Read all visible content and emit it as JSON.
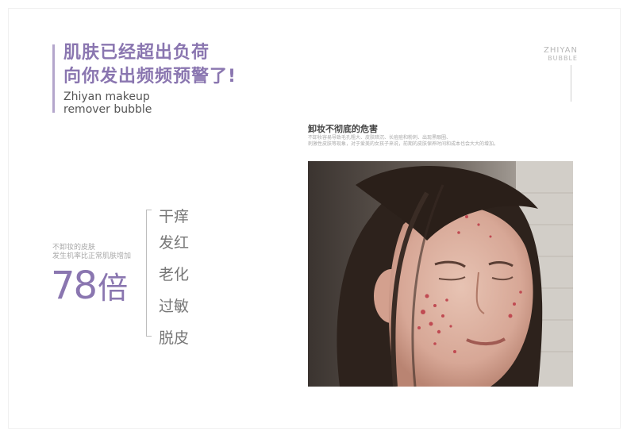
{
  "headline": {
    "line1": "肌肤已经超出负荷",
    "line2": "向你发出频频预警了!"
  },
  "subtitle": {
    "line1": "Zhiyan makeup",
    "line2": "remover bubble"
  },
  "brand": {
    "line1": "ZHIYAN",
    "line2": "BUBBLE"
  },
  "stat": {
    "label_line1": "不卸妆的皮肤",
    "label_line2": "发生机率比正常肌肤增加",
    "number": "78",
    "unit": "倍"
  },
  "symptoms": [
    "干痒",
    "发红",
    "老化",
    "过敏",
    "脱皮"
  ],
  "panel": {
    "title": "卸妆不彻底的危害",
    "desc_line1": "不卸妆容易导致毛孔粗大、皮肤暗沉、长痘痘和粉刺、出现黑眼圈、",
    "desc_line2": "刺激性皮肤等现象，对于爱美的女孩子来说，前期的皮肤保养时间和成本也会大大的增加。"
  },
  "colors": {
    "accent": "#8a76b0",
    "accent_bar": "#b4a6cc",
    "text_gray": "#777777"
  }
}
